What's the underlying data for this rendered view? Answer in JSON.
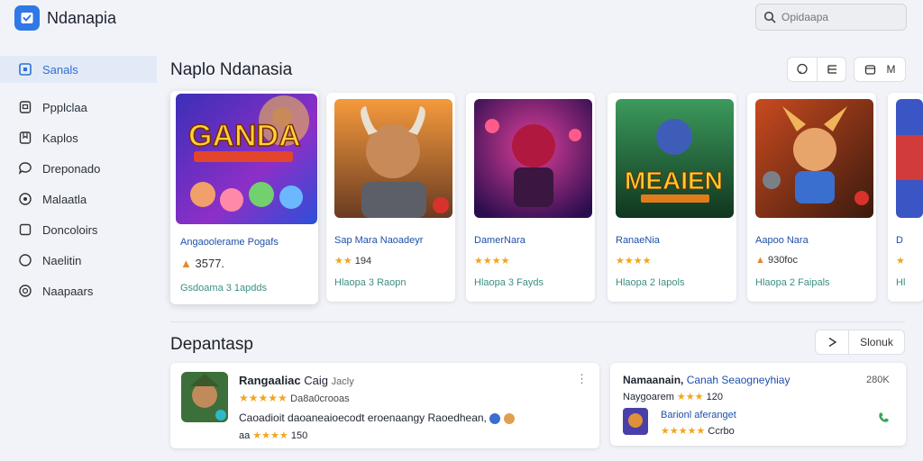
{
  "app": {
    "title": "Ndanapia"
  },
  "search": {
    "placeholder": "Opidaapa"
  },
  "sidebar": {
    "items": [
      {
        "label": "Sanals",
        "icon": "square-box-icon",
        "active": true
      },
      {
        "label": "Ppplclaa",
        "icon": "device-icon"
      },
      {
        "label": "Kaplos",
        "icon": "bookmark-icon"
      },
      {
        "label": "Dreponado",
        "icon": "chat-icon"
      },
      {
        "label": "Malaatla",
        "icon": "compass-icon"
      },
      {
        "label": "Doncoloirs",
        "icon": "square-icon"
      },
      {
        "label": "Naelitin",
        "icon": "circle-icon"
      },
      {
        "label": "Naapaars",
        "icon": "target-icon"
      }
    ]
  },
  "featured": {
    "title": "Naplo Ndanasia",
    "toolbar": {
      "right_label": "M"
    },
    "cards": [
      {
        "name": "Angaoolerame Pogafs",
        "rating": "3577.",
        "meta": "Gsdoama 3 1apdds",
        "stars": 0
      },
      {
        "name": "Sap Mara Naoadeyr",
        "rating": "194",
        "meta": "Hlaopa 3 Raopn",
        "stars": 2
      },
      {
        "name": "DamerNara",
        "rating": "",
        "meta": "Hlaopa 3 Fayds",
        "stars": 4
      },
      {
        "name": "RanaeNia",
        "rating": "",
        "meta": "Hlaopa 2 Iapols",
        "stars": 4
      },
      {
        "name": "Aapoo Nara",
        "rating": "930foc",
        "meta": "Hlaopa 2 Faipals",
        "stars": 0
      },
      {
        "name": "D",
        "rating": "",
        "meta": "Hl",
        "stars": 1
      }
    ]
  },
  "second": {
    "title": "Depantasp",
    "sort_label": "Slonuk",
    "rows": [
      {
        "title": "Rangaaliac",
        "title_extra": "Caig",
        "tag": "Jacly",
        "rating_text": "Da8a0crooas",
        "desc": "Caoadioit daoaneaioecodt eroenaangy Raoedhean,",
        "sub_rating": "150"
      },
      {
        "title": "Namaanain,",
        "title_extra": "Canah Seaogneyhiay",
        "size": "280K",
        "sub_label": "Naygoarem",
        "sub_rating": "120",
        "row2_label": "Barionl aferanget",
        "row2_rating": "Ccrbo"
      }
    ]
  },
  "colors": {
    "accent": "#2f78e6",
    "star": "#f2a51c",
    "meta": "#3b8f86",
    "link": "#1f4fa8"
  }
}
